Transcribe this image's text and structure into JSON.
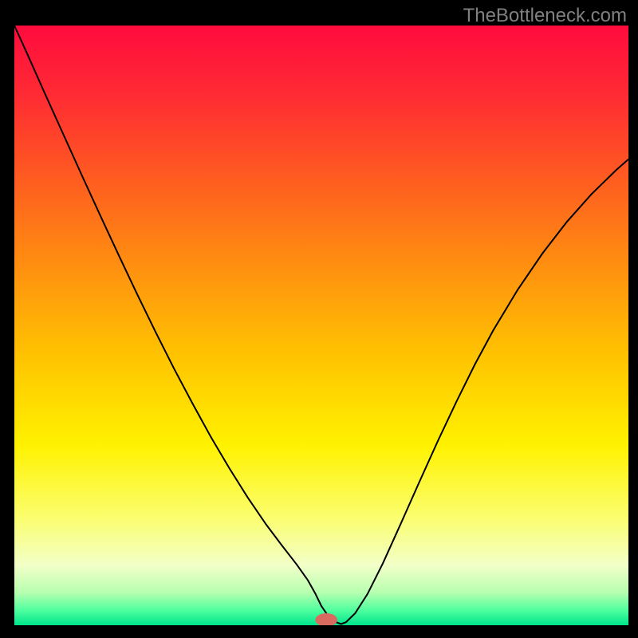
{
  "attribution": "TheBottleneck.com",
  "chart_data": {
    "type": "line",
    "title": "",
    "xlabel": "",
    "ylabel": "",
    "xlim": [
      0,
      100
    ],
    "ylim": [
      0,
      100
    ],
    "background_gradient": {
      "stops": [
        {
          "pos": 0.0,
          "color": "#ff0b3e"
        },
        {
          "pos": 0.12,
          "color": "#ff2c33"
        },
        {
          "pos": 0.25,
          "color": "#ff5a21"
        },
        {
          "pos": 0.4,
          "color": "#ff8f10"
        },
        {
          "pos": 0.55,
          "color": "#ffc300"
        },
        {
          "pos": 0.7,
          "color": "#fff200"
        },
        {
          "pos": 0.82,
          "color": "#fbfe6e"
        },
        {
          "pos": 0.9,
          "color": "#f2ffc8"
        },
        {
          "pos": 0.945,
          "color": "#b8ffb0"
        },
        {
          "pos": 0.975,
          "color": "#4fff9e"
        },
        {
          "pos": 1.0,
          "color": "#00e58c"
        }
      ]
    },
    "marker": {
      "x": 50.8,
      "y": 0.9,
      "color": "#d86a5f",
      "rx": 1.8,
      "ry": 1.1
    },
    "series": [
      {
        "name": "bottleneck-curve",
        "color": "#000000",
        "stroke_width": 2,
        "x": [
          0.0,
          2,
          5,
          8,
          11,
          14,
          17,
          20,
          23,
          26,
          29,
          32,
          35,
          38,
          41,
          43.5,
          46,
          47.8,
          49.0,
          50.0,
          51.2,
          52.4,
          53.2,
          54.0,
          55.5,
          57.5,
          60,
          63,
          66,
          69,
          72,
          75,
          78,
          82,
          86,
          90,
          94,
          98,
          100
        ],
        "y": [
          100,
          95.5,
          88.6,
          81.8,
          75.0,
          68.3,
          61.7,
          55.2,
          48.9,
          42.8,
          37.0,
          31.4,
          26.2,
          21.3,
          16.8,
          13.4,
          10.1,
          7.5,
          5.3,
          3.2,
          1.4,
          0.5,
          0.2,
          0.5,
          2.0,
          5.2,
          10.3,
          17.1,
          24.0,
          30.8,
          37.3,
          43.5,
          49.2,
          56.0,
          62.0,
          67.3,
          71.9,
          75.9,
          77.7
        ]
      }
    ]
  }
}
